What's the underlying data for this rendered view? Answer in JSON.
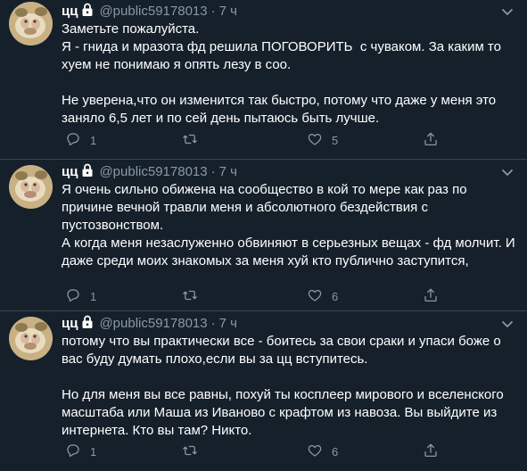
{
  "tweets": [
    {
      "name": "цц",
      "handle": "@public59178013",
      "separator": "·",
      "time": "7 ч",
      "text": "Заметьте пожалуйста.\nЯ - гнида и мразота фд решила ПОГОВОРИТЬ  с чуваком. За каким то\nхуем не понимаю я опять лезу в соо.\n\nНе уверена,что он изменится так быстро, потому что даже у меня это\nзаняло 6,5 лет и по сей день пытаюсь быть лучше.",
      "reply_count": "1",
      "retweet_count": "",
      "like_count": "5"
    },
    {
      "name": "цц",
      "handle": "@public59178013",
      "separator": "·",
      "time": "7 ч",
      "text": "Я очень сильно обижена на сообщество в кой то мере как раз по\nпричине вечной травли меня и абсолютного бездействия с\nпустозвонством.\nА когда меня незаслуженно обвиняют в серьезных вещах - фд молчит. И\nдаже среди моих знакомых за меня хуй кто публично заступится,",
      "reply_count": "1",
      "retweet_count": "",
      "like_count": "6"
    },
    {
      "name": "цц",
      "handle": "@public59178013",
      "separator": "·",
      "time": "7 ч",
      "text": "потому что вы практически все - боитесь за свои сраки и упаси боже о\nвас буду думать плохо,если вы за цц вступитесь.\n\nНо для меня вы все равны, похуй ты косплеер мирового и вселенского\nмасштаба или Маша из Иваново с крафтом из навоза. Вы выйдите из\nинтернета. Кто вы там? Никто.",
      "reply_count": "1",
      "retweet_count": "",
      "like_count": "6"
    }
  ],
  "colors": {
    "background": "#15202b",
    "text": "#ffffff",
    "muted": "#8899a6",
    "divider": "#38444d"
  },
  "icons": {
    "lock": "lock-icon",
    "caret": "chevron-down-icon",
    "reply": "reply-icon",
    "retweet": "retweet-icon",
    "like": "heart-icon",
    "share": "share-icon"
  }
}
